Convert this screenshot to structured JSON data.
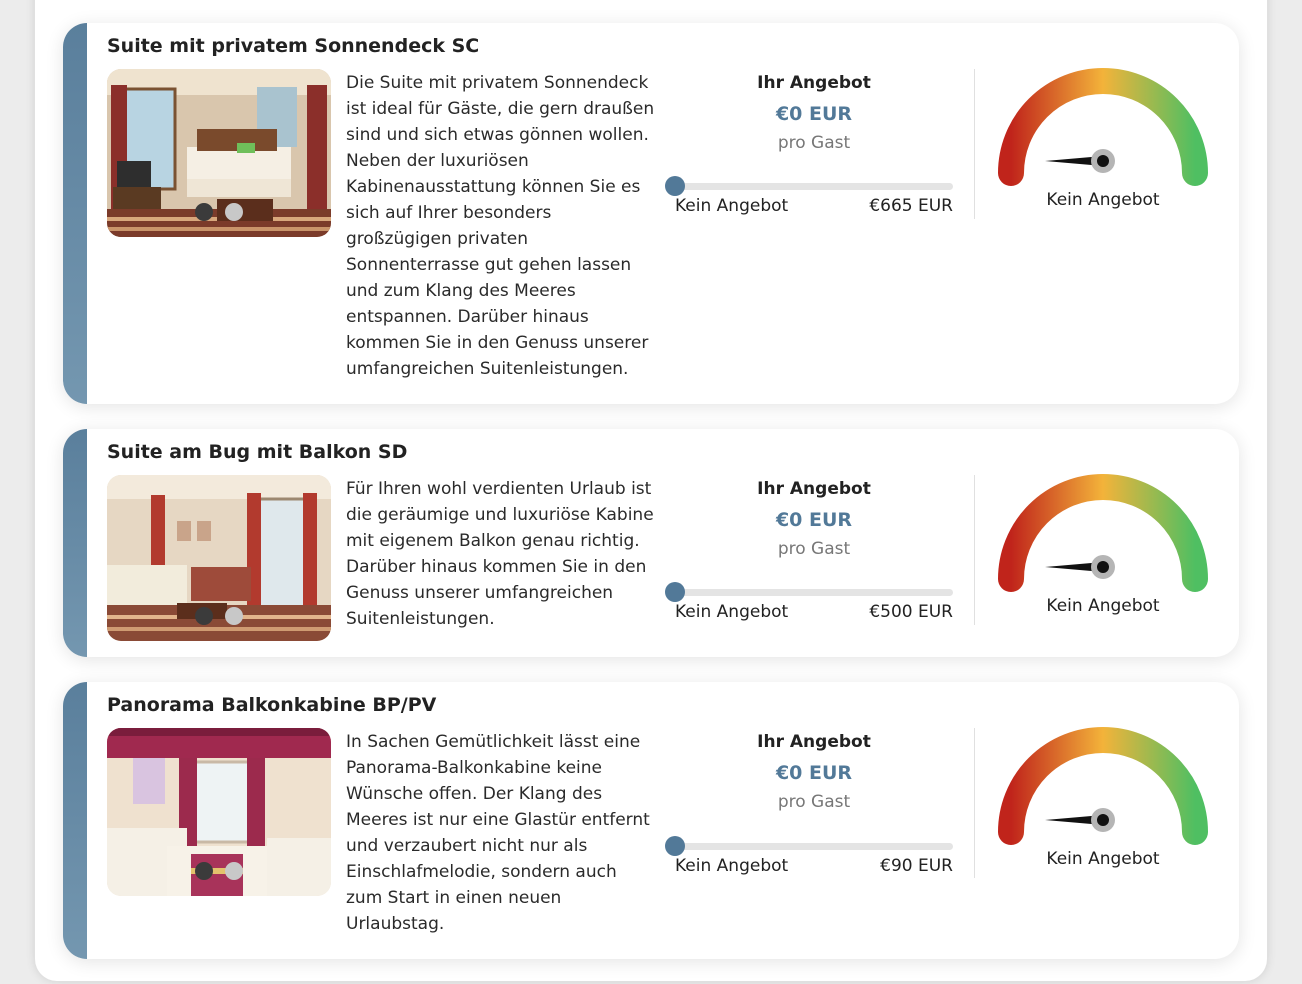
{
  "colors": {
    "accent": "#527998",
    "gauge_low": "#c0241b",
    "gauge_mid": "#f3b33a",
    "gauge_high": "#4fbf62"
  },
  "cabins": [
    {
      "title": "Suite mit privatem Sonnendeck SC",
      "description": "Die Suite mit privatem Sonnendeck ist ideal für Gäste, die gern draußen sind und sich etwas gönnen wollen. Neben der luxuriösen Kabinenausstattung können Sie es sich auf Ihrer besonders großzügigen privaten Sonnenterrasse gut gehen lassen und zum Klang des Meeres entspannen. Darüber hinaus kommen Sie in den Genuss unserer umfangreichen Suitenleistungen.",
      "offer_heading": "Ihr Angebot",
      "offer_value": "€0 EUR",
      "offer_unit": "pro Gast",
      "slider_value": 0,
      "slider_min_label": "Kein Angebot",
      "slider_max_label": "€665 EUR",
      "gauge_label": "Kein Angebot",
      "gauge_level": 0,
      "image_icon": "cabin-photo-suite-sundeck",
      "carousel_dots": 2,
      "carousel_active": 0
    },
    {
      "title": "Suite am Bug mit Balkon SD",
      "description": "Für Ihren wohl verdienten Urlaub ist die geräumige und luxuriöse Kabine mit eigenem Balkon genau richtig. Darüber hinaus kommen Sie in den Genuss unserer umfangreichen Suitenleistungen.",
      "offer_heading": "Ihr Angebot",
      "offer_value": "€0 EUR",
      "offer_unit": "pro Gast",
      "slider_value": 0,
      "slider_min_label": "Kein Angebot",
      "slider_max_label": "€500 EUR",
      "gauge_label": "Kein Angebot",
      "gauge_level": 0,
      "image_icon": "cabin-photo-suite-bow",
      "carousel_dots": 2,
      "carousel_active": 0
    },
    {
      "title": "Panorama Balkonkabine BP/PV",
      "description": "In Sachen Gemütlichkeit lässt eine Panorama-Balkonkabine keine Wünsche offen. Der Klang des Meeres ist nur eine Glastür entfernt und verzaubert nicht nur als Einschlafmelodie, sondern auch zum Start in einen neuen Urlaubstag.",
      "offer_heading": "Ihr Angebot",
      "offer_value": "€0 EUR",
      "offer_unit": "pro Gast",
      "slider_value": 0,
      "slider_min_label": "Kein Angebot",
      "slider_max_label": "€90 EUR",
      "gauge_label": "Kein Angebot",
      "gauge_level": 0,
      "image_icon": "cabin-photo-panorama-balcony",
      "carousel_dots": 2,
      "carousel_active": 0
    }
  ]
}
